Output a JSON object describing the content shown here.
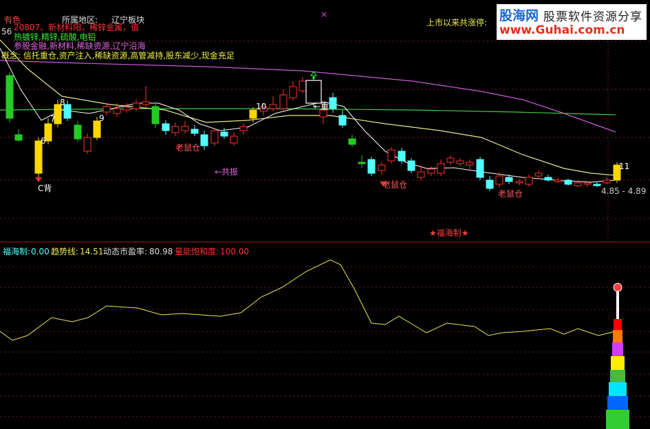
{
  "header": {
    "row1": {
      "sector": "有色",
      "region_label": "所属地区:",
      "region_value": "辽宁板块"
    },
    "row2": "20807、新材料阳，稀锌金属，值",
    "row3": "热镀锌,精锌,硫酸,电铅",
    "row4": "参股金融,新材料,稀缺资源,辽宁沿海",
    "row5": "概念: 信托重仓,资产注入,稀缺资源,高管减持,股东减少,现金充足",
    "limit_up_label": "上市以来共涨停:",
    "price_readout": "56",
    "x_mark": "×"
  },
  "watermark": {
    "brand": "股海网",
    "slogan": "股票软件资源分享",
    "url": "www.Guhai.com.cn"
  },
  "annotations": {
    "c_back": "C背",
    "num_6": "6",
    "num_7": "7",
    "num_8": "8",
    "num_9": "9",
    "num_10": "10",
    "num_11": "11",
    "laoshu_1": "老鼠仓",
    "laoshu_2": "老鼠仓",
    "laoshu_3": "老鼠仓",
    "gongzhen": "←共振",
    "chong": "←重",
    "fuhai_star": "★福海制★",
    "price_range": "4.85 - 4.89"
  },
  "indicator": {
    "fuhai_label": "福海制:",
    "fuhai_value": "0.00",
    "trend_label": "趋势线:",
    "trend_value": "14.51",
    "pe_label": "动态市盈率:",
    "pe_value": "80.98",
    "energy_label": "量能饱和度:",
    "energy_value": "100.00"
  },
  "colors": {
    "up": "#ff3232",
    "down": "#54ffff",
    "strong_up": "#ffd700",
    "green": "#22cc22",
    "ma_short": "#ffffff",
    "ma_mid": "#e8e88c",
    "ma_magenta": "#c85cd8",
    "ma_green": "#44cc44",
    "trend_line": "#e8e85a"
  }
}
